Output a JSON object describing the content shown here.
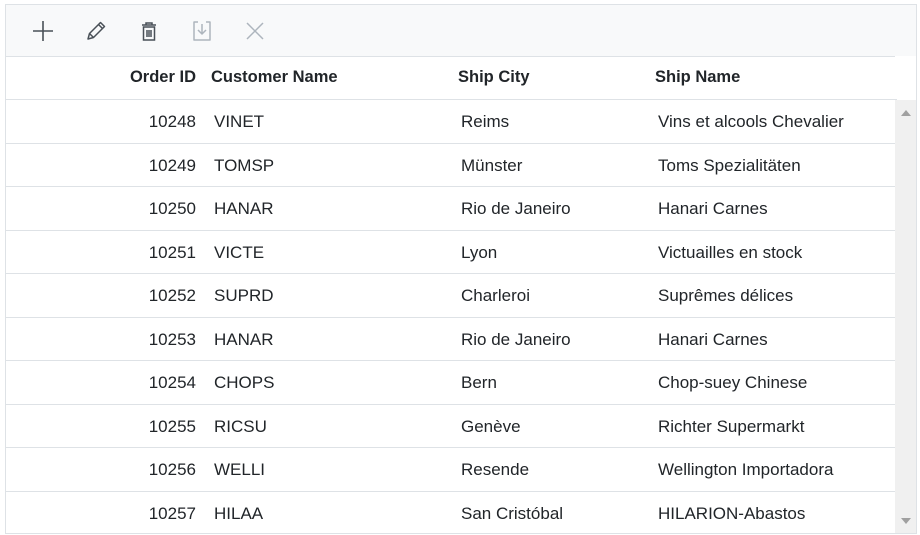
{
  "toolbar": {
    "buttons": [
      {
        "name": "add",
        "icon": "plus-icon",
        "enabled": true
      },
      {
        "name": "edit",
        "icon": "pencil-icon",
        "enabled": true
      },
      {
        "name": "delete",
        "icon": "trash-icon",
        "enabled": true
      },
      {
        "name": "update",
        "icon": "save-icon",
        "enabled": false
      },
      {
        "name": "cancel",
        "icon": "close-icon",
        "enabled": false
      }
    ]
  },
  "grid": {
    "columns": [
      "Order ID",
      "Customer Name",
      "Ship City",
      "Ship Name"
    ],
    "rows": [
      {
        "order_id": "10248",
        "customer": "VINET",
        "city": "Reims",
        "ship": "Vins et alcools Chevalier"
      },
      {
        "order_id": "10249",
        "customer": "TOMSP",
        "city": "Münster",
        "ship": "Toms Spezialitäten"
      },
      {
        "order_id": "10250",
        "customer": "HANAR",
        "city": "Rio de Janeiro",
        "ship": "Hanari Carnes"
      },
      {
        "order_id": "10251",
        "customer": "VICTE",
        "city": "Lyon",
        "ship": "Victuailles en stock"
      },
      {
        "order_id": "10252",
        "customer": "SUPRD",
        "city": "Charleroi",
        "ship": "Suprêmes délices"
      },
      {
        "order_id": "10253",
        "customer": "HANAR",
        "city": "Rio de Janeiro",
        "ship": "Hanari Carnes"
      },
      {
        "order_id": "10254",
        "customer": "CHOPS",
        "city": "Bern",
        "ship": "Chop-suey Chinese"
      },
      {
        "order_id": "10255",
        "customer": "RICSU",
        "city": "Genève",
        "ship": "Richter Supermarkt"
      },
      {
        "order_id": "10256",
        "customer": "WELLI",
        "city": "Resende",
        "ship": "Wellington Importadora"
      },
      {
        "order_id": "10257",
        "customer": "HILAA",
        "city": "San Cristóbal",
        "ship": "HILARION-Abastos"
      }
    ]
  }
}
